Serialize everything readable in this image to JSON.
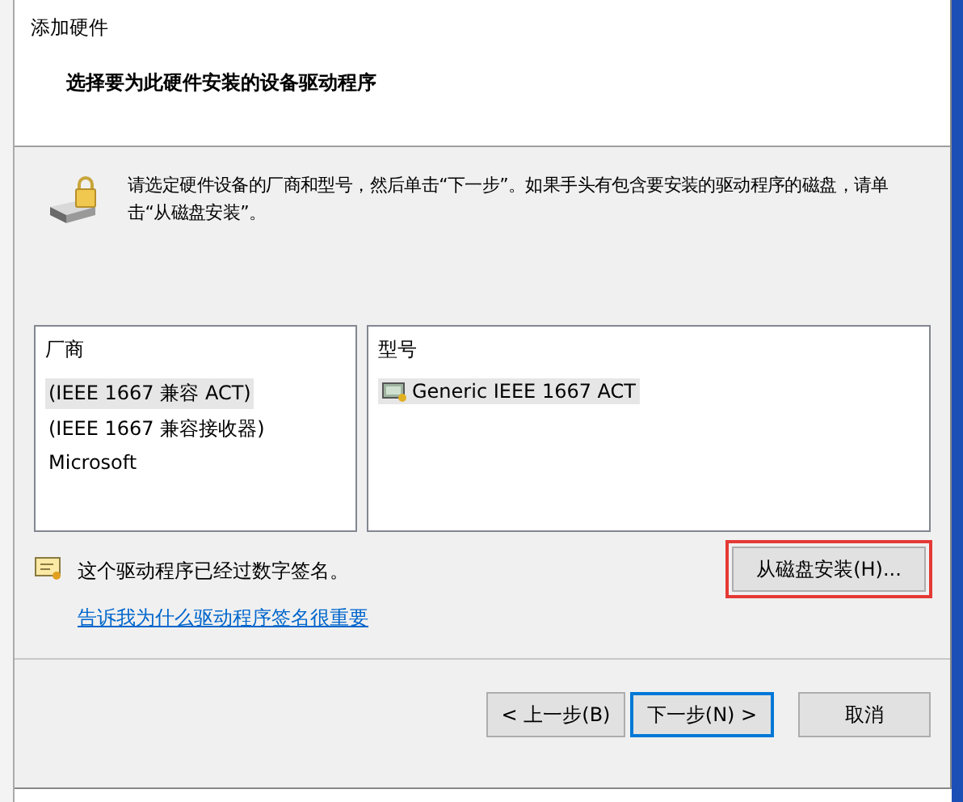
{
  "window": {
    "title": "添加硬件"
  },
  "header": {
    "subtitle": "选择要为此硬件安装的设备驱动程序"
  },
  "instruction": "请选定硬件设备的厂商和型号，然后单击“下一步”。如果手头有包含要安装的驱动程序的磁盘，请单击“从磁盘安装”。",
  "manufacturers": {
    "heading": "厂商",
    "items": [
      {
        "label": "(IEEE 1667 兼容 ACT)",
        "selected": true
      },
      {
        "label": "(IEEE 1667 兼容接收器)",
        "selected": false
      },
      {
        "label": "Microsoft",
        "selected": false
      }
    ]
  },
  "models": {
    "heading": "型号",
    "items": [
      {
        "label": "Generic IEEE 1667 ACT",
        "selected": true
      }
    ]
  },
  "signature": {
    "text": "这个驱动程序已经过数字签名。",
    "link": "告诉我为什么驱动程序签名很重要"
  },
  "have_disk_button": {
    "label": "从磁盘安装(H)...",
    "highlighted": true
  },
  "buttons": [
    {
      "label": "< 上一步(B)",
      "kind": "normal"
    },
    {
      "label": "下一步(N) >",
      "kind": "default"
    },
    {
      "label": "取消",
      "kind": "spaced"
    }
  ]
}
